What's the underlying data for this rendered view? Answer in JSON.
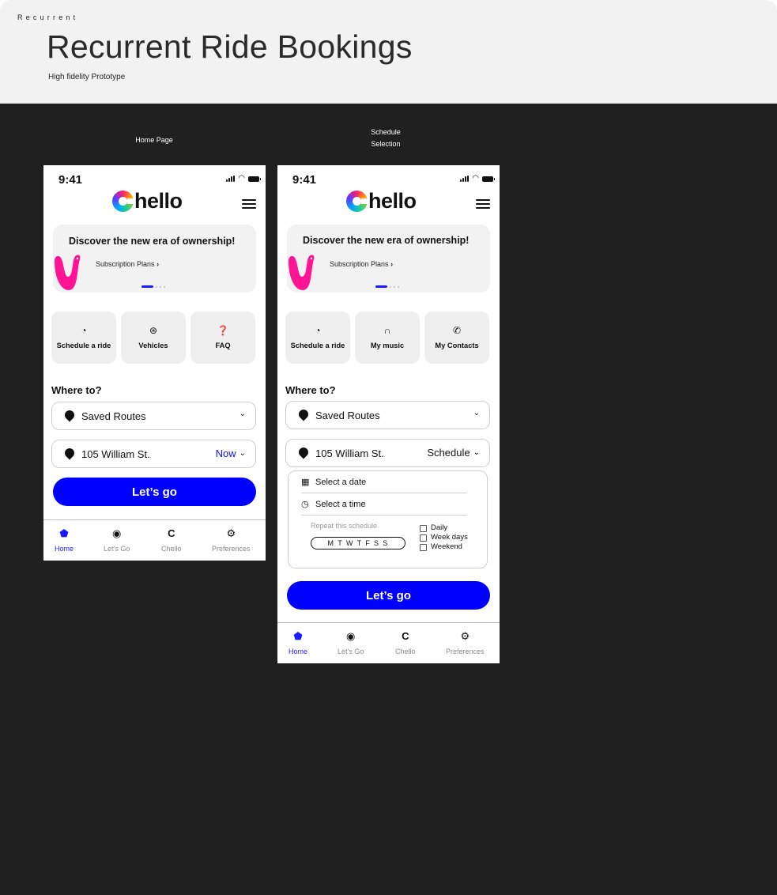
{
  "header": {
    "tag": "Recurrent",
    "title": "Recurrent Ride Bookings",
    "subtitle": "High fidelity Prototype"
  },
  "screens": [
    {
      "label": "Home Page",
      "status_time": "9:41",
      "logo_text": "hello",
      "banner": {
        "title": "Discover the new era of ownership!",
        "link": "Subscription Plans",
        "link_chevron": "›"
      },
      "tiles": [
        {
          "icon": "clock-icon",
          "label": "Schedule a ride"
        },
        {
          "icon": "steering-wheel-icon",
          "label": "Vehicles"
        },
        {
          "icon": "question-icon",
          "label": "FAQ"
        }
      ],
      "where_to": "Where to?",
      "saved_routes": "Saved Routes",
      "address": "105 William St.",
      "time_option": "Now",
      "go_button": "Let’s go",
      "nav": [
        {
          "icon": "home-icon",
          "label": "Home",
          "active": true
        },
        {
          "icon": "pin-icon",
          "label": "Let’s Go",
          "active": false
        },
        {
          "icon": "chello-icon",
          "label": "Chello",
          "active": false
        },
        {
          "icon": "gear-icon",
          "label": "Preferences",
          "active": false
        }
      ]
    },
    {
      "label": "Schedule Selection",
      "status_time": "9:41",
      "logo_text": "hello",
      "banner": {
        "title": "Discover the new era of ownership!",
        "link": "Subscription Plans",
        "link_chevron": "›"
      },
      "tiles": [
        {
          "icon": "clock-icon",
          "label": "Schedule a ride"
        },
        {
          "icon": "headphones-icon",
          "label": "My music"
        },
        {
          "icon": "phone-icon",
          "label": "My Contacts"
        }
      ],
      "where_to": "Where to?",
      "saved_routes": "Saved Routes",
      "address": "105 William St.",
      "time_option": "Schedule",
      "schedule": {
        "select_date": "Select a date",
        "select_time": "Select a time",
        "repeat_label": "Repeat this schedule",
        "days": "MTWTFSS",
        "options": [
          "Daily",
          "Week days",
          "Weekend"
        ]
      },
      "go_button": "Let’s go",
      "nav": [
        {
          "icon": "home-icon",
          "label": "Home",
          "active": true
        },
        {
          "icon": "pin-icon",
          "label": "Let’s Go",
          "active": false
        },
        {
          "icon": "chello-icon",
          "label": "Chello",
          "active": false
        },
        {
          "icon": "gear-icon",
          "label": "Preferences",
          "active": false
        }
      ]
    }
  ],
  "colors": {
    "accent": "#0000ff",
    "canvas": "#202020",
    "header_bg": "#f2f2f2",
    "worm": "#ff1493"
  }
}
